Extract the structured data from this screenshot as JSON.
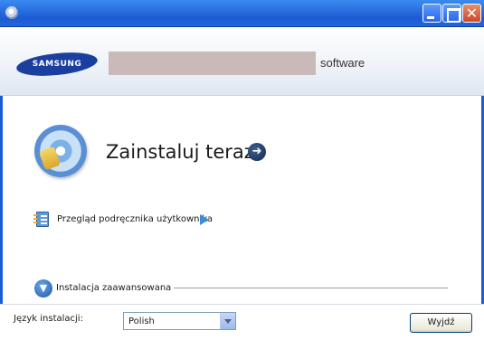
{
  "window": {
    "title": "",
    "controls": [
      "minimize",
      "maximize",
      "close"
    ]
  },
  "header": {
    "brand_logo_text": "SAMSUNG",
    "product_name_redacted": true,
    "product_suffix": "software"
  },
  "main": {
    "install_now": {
      "label": "Zainstaluj teraz",
      "icon": "install-disc-icon",
      "arrow_icon": "arrow-right-circle-icon"
    },
    "user_guide": {
      "label": "Przegląd podręcznika użytkownika",
      "icon": "user-guide-book-icon",
      "arrow_icon": "play-triangle-icon"
    },
    "advanced_install": {
      "label": "Instalacja zaawansowana",
      "icon": "expand-down-circle-icon"
    }
  },
  "footer": {
    "language_label": "Język instalacji:",
    "language_selected": "Polish",
    "exit_button": "Wyjdź"
  },
  "colors": {
    "titlebar": "#2a6fe0",
    "brand_blue": "#1b3f9e",
    "redaction": "#c9b9b9",
    "link_arrow": "#3d8bd8"
  }
}
